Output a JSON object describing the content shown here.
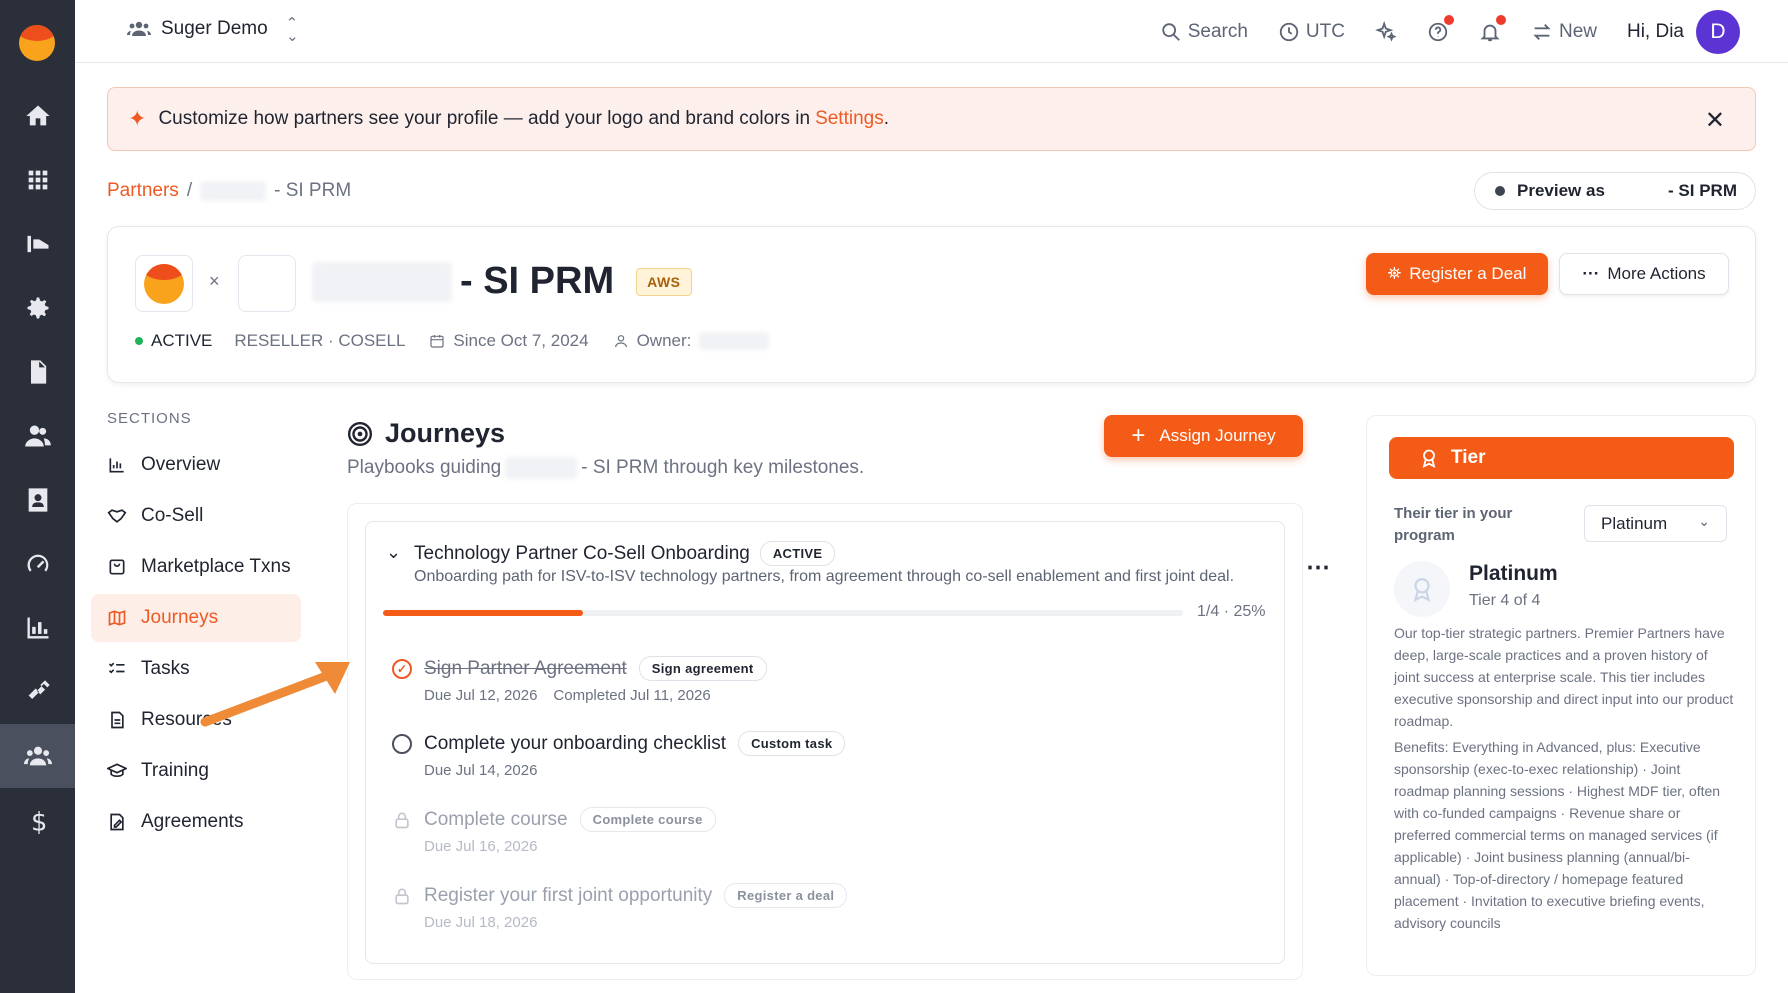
{
  "topbar": {
    "org_name": "Suger Demo",
    "search_label": "Search",
    "timezone": "UTC",
    "new_label": "New",
    "greeting": "Hi, Dia",
    "avatar_initial": "D"
  },
  "banner": {
    "text": "Customize how partners see your profile — add your logo and brand colors in",
    "link": "Settings",
    "period": "."
  },
  "breadcrumb": {
    "root": "Partners",
    "separator": "/",
    "current": "- SI PRM"
  },
  "preview": {
    "label": "Preview as",
    "value": "- SI PRM"
  },
  "partner": {
    "times": "×",
    "name_suffix": "- SI PRM",
    "cloud_badge": "AWS",
    "status": "ACTIVE",
    "type": "RESELLER · COSELL",
    "since": "Since Oct 7, 2024",
    "owner_label": "Owner:",
    "register_deal": "Register a Deal",
    "more_actions": "More Actions"
  },
  "sections": {
    "header": "SECTIONS",
    "items": [
      {
        "label": "Overview",
        "icon": "bar-chart-icon"
      },
      {
        "label": "Co-Sell",
        "icon": "handshake-icon"
      },
      {
        "label": "Marketplace Txns",
        "icon": "shopping-bag-icon"
      },
      {
        "label": "Journeys",
        "icon": "map-icon",
        "active": true
      },
      {
        "label": "Tasks",
        "icon": "checklist-icon"
      },
      {
        "label": "Resources",
        "icon": "document-icon"
      },
      {
        "label": "Training",
        "icon": "graduation-cap-icon"
      },
      {
        "label": "Agreements",
        "icon": "signature-icon"
      }
    ]
  },
  "journeys": {
    "title": "Journeys",
    "subtitle_prefix": "Playbooks guiding",
    "subtitle_suffix": "- SI PRM through key milestones.",
    "assign_label": "Assign Journey",
    "card": {
      "title": "Technology Partner Co-Sell Onboarding",
      "status": "ACTIVE",
      "description": "Onboarding path for ISV-to-ISV technology partners, from agreement through co-sell enablement and first joint deal.",
      "progress_text": "1/4 · 25%",
      "progress_fraction": 0.25
    },
    "tasks": [
      {
        "label": "Sign Partner Agreement",
        "tag": "Sign agreement",
        "due": "Due Jul 12, 2026",
        "completed": "Completed Jul 11, 2026",
        "state": "done"
      },
      {
        "label": "Complete your onboarding checklist",
        "tag": "Custom task",
        "due": "Due Jul 14, 2026",
        "state": "open"
      },
      {
        "label": "Complete course",
        "tag": "Complete course",
        "due": "Due Jul 16, 2026",
        "state": "locked"
      },
      {
        "label": "Register your first joint opportunity",
        "tag": "Register a deal",
        "due": "Due Jul 18, 2026",
        "state": "locked"
      }
    ],
    "menu_icon": "⋯"
  },
  "tier": {
    "header": "Tier",
    "program_label": "Their tier in your program",
    "selected": "Platinum",
    "name": "Platinum",
    "position": "Tier 4 of 4",
    "description": "Our top-tier strategic partners. Premier Partners have deep, large-scale practices and a proven history of joint success at enterprise scale. This tier includes executive sponsorship and direct input into our product roadmap.",
    "benefits": "Benefits: Everything in Advanced, plus: Executive sponsorship (exec-to-exec relationship) · Joint roadmap planning sessions · Highest MDF tier, often with co-funded campaigns · Revenue share or preferred commercial terms on managed services (if applicable) · Joint business planning (annual/bi-annual) · Top-of-directory / homepage featured placement · Invitation to executive briefing events, advisory councils"
  },
  "colors": {
    "accent": "#f45b16",
    "rail": "#2a2f3a",
    "success": "#21b35a"
  }
}
